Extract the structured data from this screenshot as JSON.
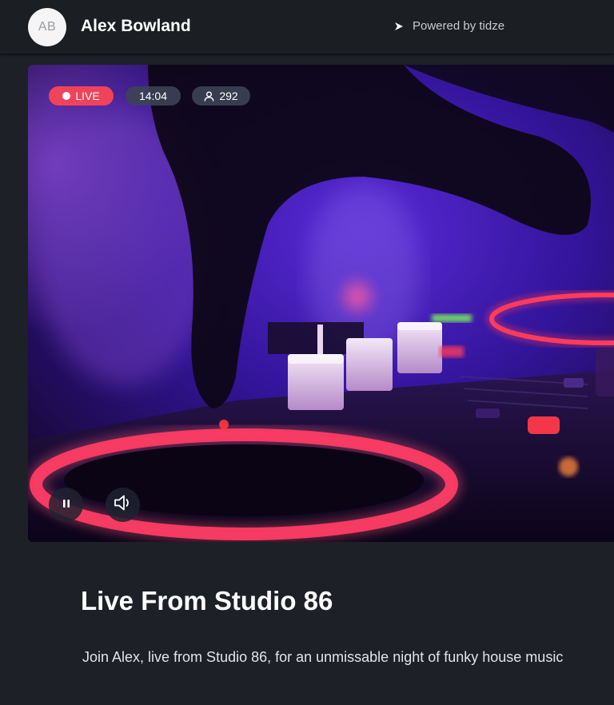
{
  "header": {
    "avatar_initials": "AB",
    "host_name": "Alex Bowland",
    "powered_by": "Powered by tidze",
    "powered_icon": "play-icon"
  },
  "player": {
    "live_label": "LIVE",
    "elapsed_time": "14:04",
    "viewer_count": "292",
    "viewer_icon": "user-icon",
    "pause_icon": "pause-icon",
    "volume_icon": "volume-icon",
    "colors": {
      "live": "#f0435a",
      "chip": "#3c4454",
      "neon_red": "#ff2e5a",
      "neon_purple": "#7a2cff"
    }
  },
  "content": {
    "title": "Live From Studio 86",
    "description": "Join Alex, live from Studio 86, for an unmissable night of funky house music"
  }
}
